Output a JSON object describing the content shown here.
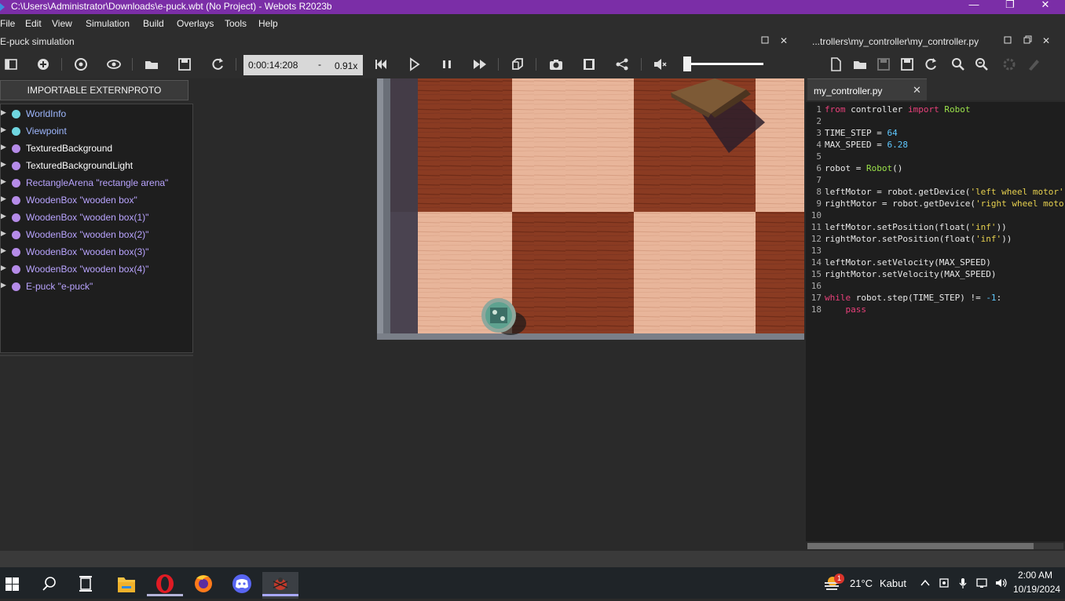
{
  "window": {
    "title": "C:\\Users\\Administrator\\Downloads\\e-puck.wbt (No Project) - Webots R2023b",
    "minimize": "—",
    "maximize": "❐",
    "close": "✕"
  },
  "menu": [
    "File",
    "Edit",
    "View",
    "Simulation",
    "Build",
    "Overlays",
    "Tools",
    "Help"
  ],
  "simulation_panel": {
    "title": "E-puck simulation",
    "time": "0:00:14:208",
    "speed_dash": "-",
    "speed": "0.91x"
  },
  "scene_tree": {
    "externproto_button": "IMPORTABLE EXTERNPROTO",
    "items": [
      {
        "label": "WorldInfo",
        "color": "#6fd6e0",
        "label_color": "#9fb8ff"
      },
      {
        "label": "Viewpoint",
        "color": "#6fd6e0",
        "label_color": "#9fb8ff"
      },
      {
        "label": "TexturedBackground",
        "color": "#b58be8",
        "label_color": "#ffffff"
      },
      {
        "label": "TexturedBackgroundLight",
        "color": "#b58be8",
        "label_color": "#ffffff"
      },
      {
        "label": "RectangleArena \"rectangle arena\"",
        "color": "#b58be8",
        "label_color": "#b9a4ff"
      },
      {
        "label": "WoodenBox \"wooden box\"",
        "color": "#b58be8",
        "label_color": "#b9a4ff"
      },
      {
        "label": "WoodenBox \"wooden box(1)\"",
        "color": "#b58be8",
        "label_color": "#b9a4ff"
      },
      {
        "label": "WoodenBox \"wooden box(2)\"",
        "color": "#b58be8",
        "label_color": "#b9a4ff"
      },
      {
        "label": "WoodenBox \"wooden box(3)\"",
        "color": "#b58be8",
        "label_color": "#b9a4ff"
      },
      {
        "label": "WoodenBox \"wooden box(4)\"",
        "color": "#b58be8",
        "label_color": "#b9a4ff"
      },
      {
        "label": "E-puck \"e-puck\"",
        "color": "#b58be8",
        "label_color": "#b9a4ff"
      }
    ]
  },
  "editor": {
    "panel_title": "...trollers\\my_controller\\my_controller.py",
    "tab_label": "my_controller.py",
    "tab_close": "✕",
    "lines": [
      {
        "n": "1",
        "html": "<span class=\"kw\">from</span> controller <span class=\"kw\">import</span> <span class=\"cls\">Robot</span>"
      },
      {
        "n": "2",
        "html": ""
      },
      {
        "n": "3",
        "html": "TIME_STEP = <span class=\"num\">64</span>"
      },
      {
        "n": "4",
        "html": "MAX_SPEED = <span class=\"num\">6.28</span>"
      },
      {
        "n": "5",
        "html": ""
      },
      {
        "n": "6",
        "html": "robot = <span class=\"cls\">Robot</span>()"
      },
      {
        "n": "7",
        "html": ""
      },
      {
        "n": "8",
        "html": "leftMotor = robot.getDevice(<span class=\"str\">'left wheel motor'</span>)"
      },
      {
        "n": "9",
        "html": "rightMotor = robot.getDevice(<span class=\"str\">'right wheel motor'</span>)"
      },
      {
        "n": "10",
        "html": ""
      },
      {
        "n": "11",
        "html": "leftMotor.setPosition(float(<span class=\"str\">'inf'</span>))"
      },
      {
        "n": "12",
        "html": "rightMotor.setPosition(float(<span class=\"str\">'inf'</span>))"
      },
      {
        "n": "13",
        "html": ""
      },
      {
        "n": "14",
        "html": "leftMotor.setVelocity(MAX_SPEED)"
      },
      {
        "n": "15",
        "html": "rightMotor.setVelocity(MAX_SPEED)"
      },
      {
        "n": "16",
        "html": ""
      },
      {
        "n": "17",
        "html": "<span class=\"kw\">while</span> robot.step(TIME_STEP) != <span class=\"num\">-1</span>:"
      },
      {
        "n": "18",
        "html": "    <span class=\"kw\">pass</span>"
      }
    ]
  },
  "taskbar": {
    "weather_badge": "1",
    "temperature": "21°C",
    "weather": "Kabut",
    "time": "2:00 AM",
    "date": "10/19/2024"
  }
}
